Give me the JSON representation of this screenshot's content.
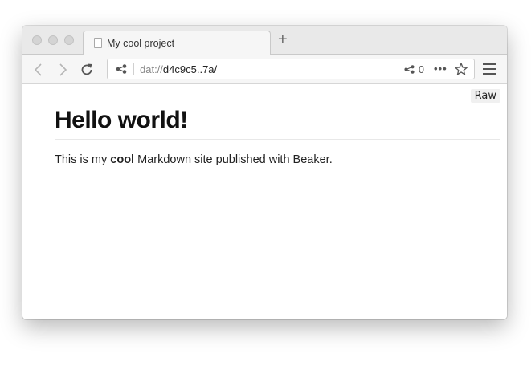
{
  "window": {
    "tab_title": "My cool project",
    "new_tab_label": "+"
  },
  "toolbar": {
    "url_scheme": "dat://",
    "url_host": "d4c9c5..7a/",
    "peer_count": "0",
    "more_label": "•••"
  },
  "content": {
    "raw_label": "Raw",
    "heading": "Hello world!",
    "paragraph_before": "This is my ",
    "paragraph_bold": "cool",
    "paragraph_after": " Markdown site published with Beaker."
  },
  "icons": {
    "back": "chevron-left-icon",
    "forward": "chevron-right-icon",
    "reload": "reload-icon",
    "share": "share-icon",
    "star": "star-icon",
    "menu": "hamburger-menu-icon",
    "page": "page-icon"
  }
}
